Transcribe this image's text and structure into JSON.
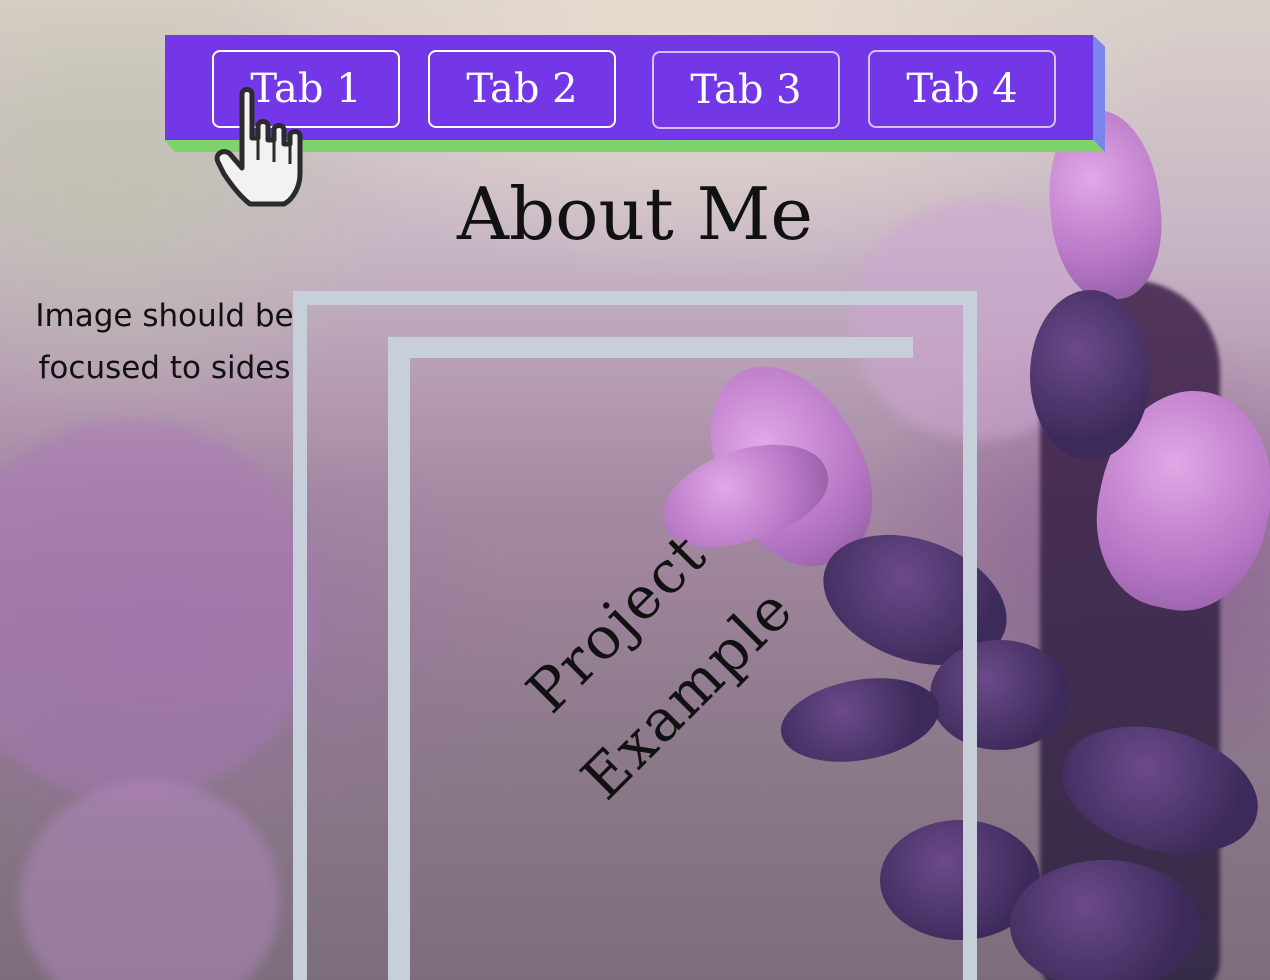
{
  "nav": {
    "tabs": [
      {
        "label": "Tab 1"
      },
      {
        "label": "Tab 2"
      },
      {
        "label": "Tab 3"
      },
      {
        "label": "Tab 4"
      }
    ]
  },
  "page": {
    "title": "About Me",
    "note_line1": "Image should be",
    "note_line2": "focused to sides"
  },
  "project": {
    "line1": "Project",
    "line2": "Example"
  },
  "colors": {
    "nav_bg": "#7437e8",
    "nav_edge_bottom": "#7ed36a",
    "nav_edge_right": "#7a86f0",
    "frame": "#c7d0da"
  },
  "icons": {
    "cursor": "hand-pointer-icon"
  }
}
